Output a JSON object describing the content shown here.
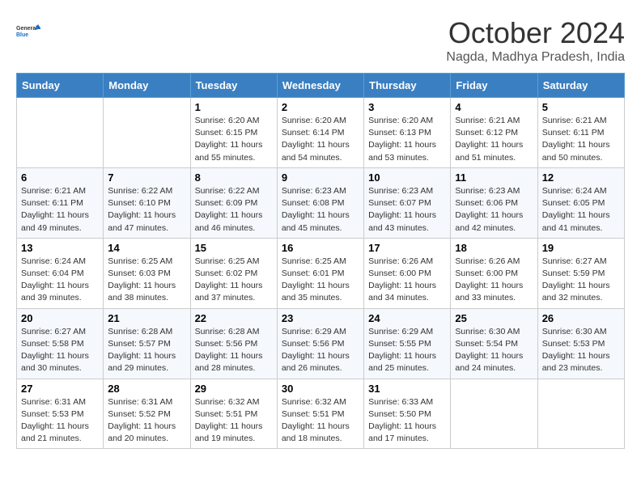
{
  "logo": {
    "general": "General",
    "blue": "Blue"
  },
  "header": {
    "month": "October 2024",
    "location": "Nagda, Madhya Pradesh, India"
  },
  "weekdays": [
    "Sunday",
    "Monday",
    "Tuesday",
    "Wednesday",
    "Thursday",
    "Friday",
    "Saturday"
  ],
  "weeks": [
    [
      {
        "day": "",
        "sunrise": "",
        "sunset": "",
        "daylight": ""
      },
      {
        "day": "",
        "sunrise": "",
        "sunset": "",
        "daylight": ""
      },
      {
        "day": "1",
        "sunrise": "Sunrise: 6:20 AM",
        "sunset": "Sunset: 6:15 PM",
        "daylight": "Daylight: 11 hours and 55 minutes."
      },
      {
        "day": "2",
        "sunrise": "Sunrise: 6:20 AM",
        "sunset": "Sunset: 6:14 PM",
        "daylight": "Daylight: 11 hours and 54 minutes."
      },
      {
        "day": "3",
        "sunrise": "Sunrise: 6:20 AM",
        "sunset": "Sunset: 6:13 PM",
        "daylight": "Daylight: 11 hours and 53 minutes."
      },
      {
        "day": "4",
        "sunrise": "Sunrise: 6:21 AM",
        "sunset": "Sunset: 6:12 PM",
        "daylight": "Daylight: 11 hours and 51 minutes."
      },
      {
        "day": "5",
        "sunrise": "Sunrise: 6:21 AM",
        "sunset": "Sunset: 6:11 PM",
        "daylight": "Daylight: 11 hours and 50 minutes."
      }
    ],
    [
      {
        "day": "6",
        "sunrise": "Sunrise: 6:21 AM",
        "sunset": "Sunset: 6:11 PM",
        "daylight": "Daylight: 11 hours and 49 minutes."
      },
      {
        "day": "7",
        "sunrise": "Sunrise: 6:22 AM",
        "sunset": "Sunset: 6:10 PM",
        "daylight": "Daylight: 11 hours and 47 minutes."
      },
      {
        "day": "8",
        "sunrise": "Sunrise: 6:22 AM",
        "sunset": "Sunset: 6:09 PM",
        "daylight": "Daylight: 11 hours and 46 minutes."
      },
      {
        "day": "9",
        "sunrise": "Sunrise: 6:23 AM",
        "sunset": "Sunset: 6:08 PM",
        "daylight": "Daylight: 11 hours and 45 minutes."
      },
      {
        "day": "10",
        "sunrise": "Sunrise: 6:23 AM",
        "sunset": "Sunset: 6:07 PM",
        "daylight": "Daylight: 11 hours and 43 minutes."
      },
      {
        "day": "11",
        "sunrise": "Sunrise: 6:23 AM",
        "sunset": "Sunset: 6:06 PM",
        "daylight": "Daylight: 11 hours and 42 minutes."
      },
      {
        "day": "12",
        "sunrise": "Sunrise: 6:24 AM",
        "sunset": "Sunset: 6:05 PM",
        "daylight": "Daylight: 11 hours and 41 minutes."
      }
    ],
    [
      {
        "day": "13",
        "sunrise": "Sunrise: 6:24 AM",
        "sunset": "Sunset: 6:04 PM",
        "daylight": "Daylight: 11 hours and 39 minutes."
      },
      {
        "day": "14",
        "sunrise": "Sunrise: 6:25 AM",
        "sunset": "Sunset: 6:03 PM",
        "daylight": "Daylight: 11 hours and 38 minutes."
      },
      {
        "day": "15",
        "sunrise": "Sunrise: 6:25 AM",
        "sunset": "Sunset: 6:02 PM",
        "daylight": "Daylight: 11 hours and 37 minutes."
      },
      {
        "day": "16",
        "sunrise": "Sunrise: 6:25 AM",
        "sunset": "Sunset: 6:01 PM",
        "daylight": "Daylight: 11 hours and 35 minutes."
      },
      {
        "day": "17",
        "sunrise": "Sunrise: 6:26 AM",
        "sunset": "Sunset: 6:00 PM",
        "daylight": "Daylight: 11 hours and 34 minutes."
      },
      {
        "day": "18",
        "sunrise": "Sunrise: 6:26 AM",
        "sunset": "Sunset: 6:00 PM",
        "daylight": "Daylight: 11 hours and 33 minutes."
      },
      {
        "day": "19",
        "sunrise": "Sunrise: 6:27 AM",
        "sunset": "Sunset: 5:59 PM",
        "daylight": "Daylight: 11 hours and 32 minutes."
      }
    ],
    [
      {
        "day": "20",
        "sunrise": "Sunrise: 6:27 AM",
        "sunset": "Sunset: 5:58 PM",
        "daylight": "Daylight: 11 hours and 30 minutes."
      },
      {
        "day": "21",
        "sunrise": "Sunrise: 6:28 AM",
        "sunset": "Sunset: 5:57 PM",
        "daylight": "Daylight: 11 hours and 29 minutes."
      },
      {
        "day": "22",
        "sunrise": "Sunrise: 6:28 AM",
        "sunset": "Sunset: 5:56 PM",
        "daylight": "Daylight: 11 hours and 28 minutes."
      },
      {
        "day": "23",
        "sunrise": "Sunrise: 6:29 AM",
        "sunset": "Sunset: 5:56 PM",
        "daylight": "Daylight: 11 hours and 26 minutes."
      },
      {
        "day": "24",
        "sunrise": "Sunrise: 6:29 AM",
        "sunset": "Sunset: 5:55 PM",
        "daylight": "Daylight: 11 hours and 25 minutes."
      },
      {
        "day": "25",
        "sunrise": "Sunrise: 6:30 AM",
        "sunset": "Sunset: 5:54 PM",
        "daylight": "Daylight: 11 hours and 24 minutes."
      },
      {
        "day": "26",
        "sunrise": "Sunrise: 6:30 AM",
        "sunset": "Sunset: 5:53 PM",
        "daylight": "Daylight: 11 hours and 23 minutes."
      }
    ],
    [
      {
        "day": "27",
        "sunrise": "Sunrise: 6:31 AM",
        "sunset": "Sunset: 5:53 PM",
        "daylight": "Daylight: 11 hours and 21 minutes."
      },
      {
        "day": "28",
        "sunrise": "Sunrise: 6:31 AM",
        "sunset": "Sunset: 5:52 PM",
        "daylight": "Daylight: 11 hours and 20 minutes."
      },
      {
        "day": "29",
        "sunrise": "Sunrise: 6:32 AM",
        "sunset": "Sunset: 5:51 PM",
        "daylight": "Daylight: 11 hours and 19 minutes."
      },
      {
        "day": "30",
        "sunrise": "Sunrise: 6:32 AM",
        "sunset": "Sunset: 5:51 PM",
        "daylight": "Daylight: 11 hours and 18 minutes."
      },
      {
        "day": "31",
        "sunrise": "Sunrise: 6:33 AM",
        "sunset": "Sunset: 5:50 PM",
        "daylight": "Daylight: 11 hours and 17 minutes."
      },
      {
        "day": "",
        "sunrise": "",
        "sunset": "",
        "daylight": ""
      },
      {
        "day": "",
        "sunrise": "",
        "sunset": "",
        "daylight": ""
      }
    ]
  ]
}
